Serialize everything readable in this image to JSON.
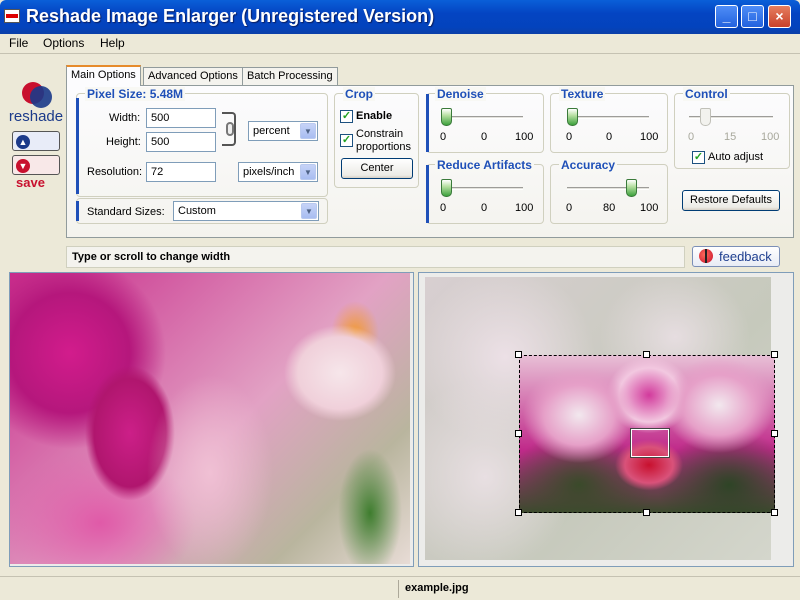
{
  "window": {
    "title": "Reshade Image Enlarger (Unregistered Version)",
    "min_glyph": "_",
    "max_glyph": "□",
    "close_glyph": "×"
  },
  "menu": [
    "File",
    "Options",
    "Help"
  ],
  "logo": {
    "text": "reshade"
  },
  "side_buttons": {
    "open": "open",
    "save": "save"
  },
  "tabs": [
    "Main Options",
    "Advanced Options",
    "Batch Processing"
  ],
  "pixel_size": {
    "title": "Pixel Size: 5.48M",
    "width_label": "Width:",
    "width_value": "500",
    "height_label": "Height:",
    "height_value": "500",
    "unit": "percent",
    "resolution_label": "Resolution:",
    "resolution_value": "72",
    "resolution_unit": "pixels/inch",
    "standard_label": "Standard Sizes:",
    "standard_value": "Custom"
  },
  "crop": {
    "title": "Crop",
    "enable_label": "Enable",
    "enable_checked": true,
    "constrain_label": "Constrain proportions",
    "constrain_checked": true,
    "center_label": "Center"
  },
  "denoise": {
    "title": "Denoise",
    "min": "0",
    "value": "0",
    "max": "100"
  },
  "texture": {
    "title": "Texture",
    "min": "0",
    "value": "0",
    "max": "100"
  },
  "control": {
    "title": "Control",
    "min": "0",
    "value": "15",
    "max": "100",
    "auto_label": "Auto adjust",
    "auto_checked": true
  },
  "reduce": {
    "title": "Reduce Artifacts",
    "min": "0",
    "value": "0",
    "max": "100"
  },
  "accuracy": {
    "title": "Accuracy",
    "min": "0",
    "value": "80",
    "max": "100"
  },
  "restore_label": "Restore Defaults",
  "hint": "Type or scroll to change width",
  "feedback_label": "feedback",
  "status": {
    "filename": "example.jpg"
  },
  "check_glyph": "✓",
  "dropdown_glyph": "▼"
}
